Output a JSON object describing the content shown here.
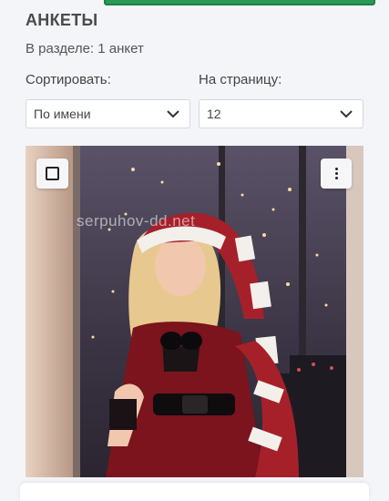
{
  "header": {
    "title": "АНКЕТЫ",
    "count_text": "В разделе: 1 анкет"
  },
  "controls": {
    "sort_label": "Сортировать:",
    "sort_value": "По имени",
    "per_page_label": "На страницу:",
    "per_page_value": "12"
  },
  "card": {
    "watermark": "serpuhov-dd.net",
    "checkbox_icon": "checkbox-icon",
    "menu_icon": "more-vertical-icon"
  },
  "colors": {
    "accent_bar": "#2c9a56",
    "background": "#f4f5f9"
  }
}
